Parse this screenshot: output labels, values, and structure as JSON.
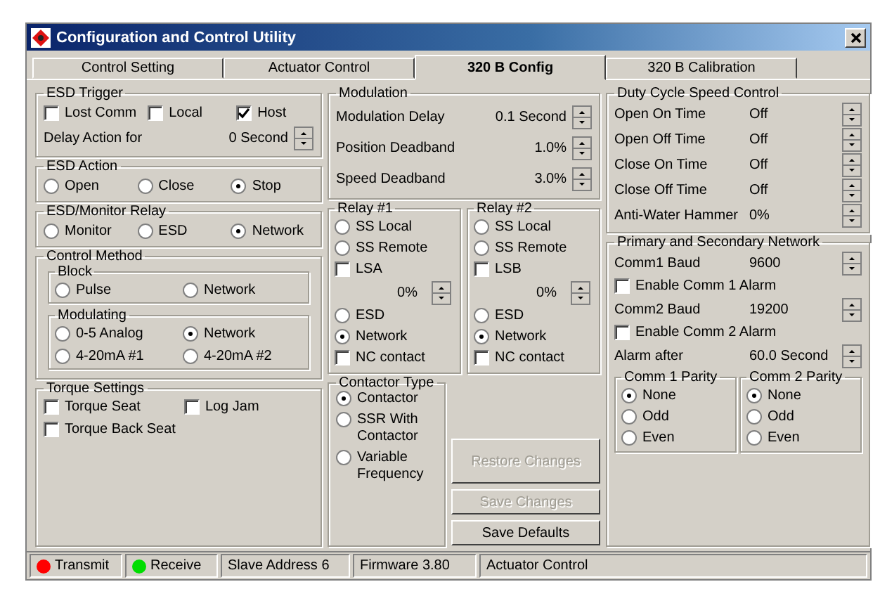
{
  "window": {
    "title": "Configuration and Control Utility"
  },
  "tabs": [
    {
      "label": "Control Setting",
      "selected": false
    },
    {
      "label": "Actuator Control",
      "selected": false
    },
    {
      "label": "320 B Config",
      "selected": true
    },
    {
      "label": "320 B Calibration",
      "selected": false
    }
  ],
  "esd_trigger": {
    "title": "ESD Trigger",
    "options": [
      {
        "label": "Lost Comm",
        "checked": false
      },
      {
        "label": "Local",
        "checked": false
      },
      {
        "label": "Host",
        "checked": true
      }
    ],
    "delay": {
      "label": "Delay Action for",
      "value": "0 Second"
    }
  },
  "esd_action": {
    "title": "ESD Action",
    "options": [
      {
        "label": "Open",
        "selected": false
      },
      {
        "label": "Close",
        "selected": false
      },
      {
        "label": "Stop",
        "selected": true
      }
    ]
  },
  "esd_relay": {
    "title": "ESD/Monitor Relay",
    "options": [
      {
        "label": "Monitor",
        "selected": false
      },
      {
        "label": "ESD",
        "selected": false
      },
      {
        "label": "Network",
        "selected": true
      }
    ]
  },
  "control_method": {
    "title": "Control Method",
    "block": {
      "title": "Block",
      "options": [
        {
          "label": "Pulse",
          "selected": false
        },
        {
          "label": "Network",
          "selected": false
        }
      ]
    },
    "modulating": {
      "title": "Modulating",
      "options": [
        {
          "label": "0-5 Analog",
          "selected": false
        },
        {
          "label": "Network",
          "selected": true
        },
        {
          "label": "4-20mA #1",
          "selected": false
        },
        {
          "label": "4-20mA #2",
          "selected": false
        }
      ]
    }
  },
  "torque": {
    "title": "Torque Settings",
    "options": [
      {
        "label": "Torque Seat",
        "checked": false
      },
      {
        "label": "Log Jam",
        "checked": false
      },
      {
        "label": "Torque Back Seat",
        "checked": false
      }
    ]
  },
  "modulation": {
    "title": "Modulation",
    "fields": [
      {
        "label": "Modulation Delay",
        "value": "0.1 Second"
      },
      {
        "label": "Position Deadband",
        "value": "1.0%"
      },
      {
        "label": "Speed Deadband",
        "value": "3.0%"
      }
    ]
  },
  "relays": [
    {
      "title": "Relay #1",
      "items": [
        {
          "kind": "radio",
          "label": "SS Local",
          "selected": false
        },
        {
          "kind": "radio",
          "label": "SS Remote",
          "selected": false
        },
        {
          "kind": "checkbox",
          "label": "LSA",
          "checked": false
        },
        {
          "kind": "spin",
          "value": "0%"
        },
        {
          "kind": "radio",
          "label": "ESD",
          "selected": false
        },
        {
          "kind": "radio",
          "label": "Network",
          "selected": true
        },
        {
          "kind": "checkbox",
          "label": "NC contact",
          "checked": false
        }
      ]
    },
    {
      "title": "Relay #2",
      "items": [
        {
          "kind": "radio",
          "label": "SS Local",
          "selected": false
        },
        {
          "kind": "radio",
          "label": "SS Remote",
          "selected": false
        },
        {
          "kind": "checkbox",
          "label": "LSB",
          "checked": false
        },
        {
          "kind": "spin",
          "value": "0%"
        },
        {
          "kind": "radio",
          "label": "ESD",
          "selected": false
        },
        {
          "kind": "radio",
          "label": "Network",
          "selected": true
        },
        {
          "kind": "checkbox",
          "label": "NC contact",
          "checked": false
        }
      ]
    }
  ],
  "contactor_type": {
    "title": "Contactor Type",
    "options": [
      {
        "label": "Contactor",
        "selected": true
      },
      {
        "label": "SSR With Contactor",
        "selected": false
      },
      {
        "label": "Variable Frequency",
        "selected": false
      }
    ]
  },
  "buttons": [
    {
      "label": "Restore Changes",
      "disabled": true
    },
    {
      "label": "Save Changes",
      "disabled": true
    },
    {
      "label": "Save Defaults",
      "disabled": false
    }
  ],
  "duty_cycle": {
    "title": "Duty Cycle Speed Control",
    "fields": [
      {
        "label": "Open On Time",
        "value": "Off"
      },
      {
        "label": "Open Off Time",
        "value": "Off"
      },
      {
        "label": "Close On Time",
        "value": "Off"
      },
      {
        "label": "Close Off Time",
        "value": "Off"
      },
      {
        "label": "Anti-Water Hammer",
        "value": "0%"
      }
    ]
  },
  "network": {
    "title": "Primary and Secondary Network",
    "items": [
      {
        "kind": "spin",
        "label": "Comm1 Baud",
        "value": "9600"
      },
      {
        "kind": "checkbox",
        "label": "Enable Comm 1 Alarm",
        "checked": false
      },
      {
        "kind": "spin",
        "label": "Comm2 Baud",
        "value": "19200"
      },
      {
        "kind": "checkbox",
        "label": "Enable Comm 2 Alarm",
        "checked": false
      },
      {
        "kind": "spin",
        "label": "Alarm after",
        "value": "60.0 Second"
      }
    ],
    "parity": [
      {
        "title": "Comm 1 Parity",
        "options": [
          {
            "label": "None",
            "selected": true
          },
          {
            "label": "Odd",
            "selected": false
          },
          {
            "label": "Even",
            "selected": false
          }
        ]
      },
      {
        "title": "Comm 2 Parity",
        "options": [
          {
            "label": "None",
            "selected": true
          },
          {
            "label": "Odd",
            "selected": false
          },
          {
            "label": "Even",
            "selected": false
          }
        ]
      }
    ]
  },
  "status_bar": [
    {
      "kind": "led",
      "label": "Transmit",
      "color": "#ff0000"
    },
    {
      "kind": "led",
      "label": "Receive",
      "color": "#00dd00"
    },
    {
      "kind": "text",
      "label": "Slave Address 6"
    },
    {
      "kind": "text",
      "label": "Firmware 3.80"
    },
    {
      "kind": "text",
      "label": "Actuator Control"
    }
  ]
}
